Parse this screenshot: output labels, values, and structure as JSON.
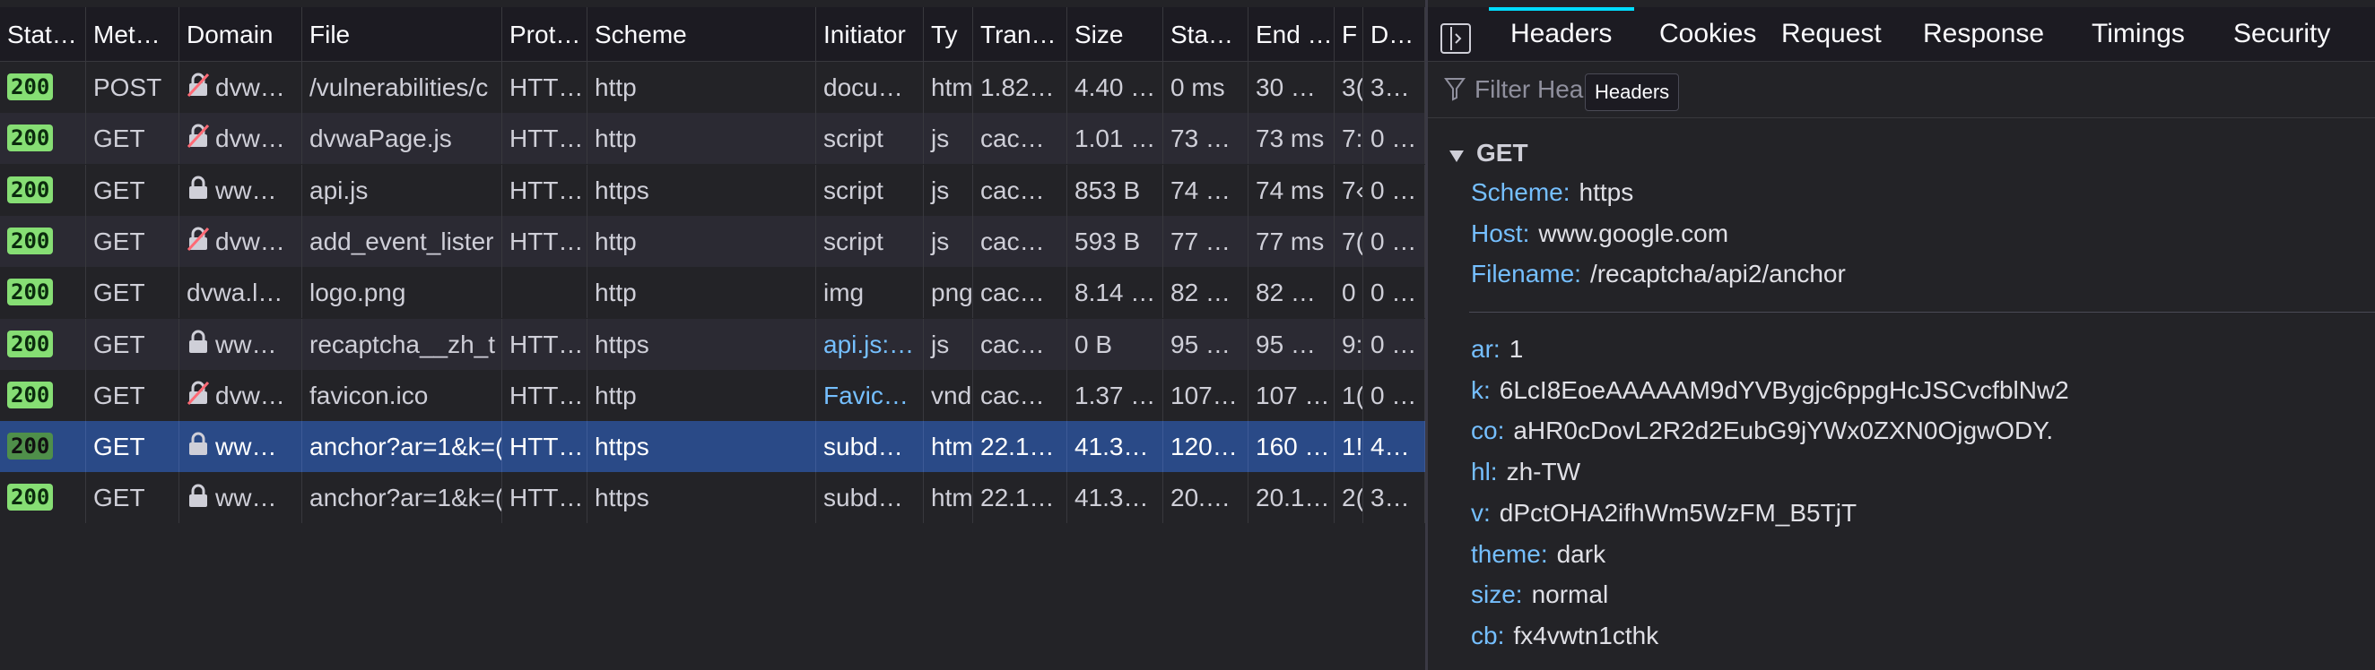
{
  "table": {
    "columns": [
      "Stat…",
      "Met…",
      "Domain",
      "File",
      "Prot…",
      "Scheme",
      "Initiator",
      "Ty",
      "Tran…",
      "Size",
      "Sta…",
      "End …",
      "F",
      "D…"
    ],
    "rows": [
      {
        "status": "200",
        "method": "POST",
        "domain": "dvw…",
        "domain_icon": "insecure-lock-icon",
        "file": "/vulnerabilities/c",
        "protocol": "HTT…",
        "scheme": "http",
        "initiator": "docu…",
        "type": "htm",
        "transferred": "1.82…",
        "size": "4.40 …",
        "start": "0 ms",
        "end": "30 …",
        "f": "3(",
        "d": "3…"
      },
      {
        "status": "200",
        "method": "GET",
        "domain": "dvw…",
        "domain_icon": "insecure-lock-icon",
        "file": "dvwaPage.js",
        "protocol": "HTT…",
        "scheme": "http",
        "initiator": "script",
        "type": "js",
        "transferred": "cac…",
        "size": "1.01 …",
        "start": "73 …",
        "end": "73 ms",
        "f": "7:",
        "d": "0 …"
      },
      {
        "status": "200",
        "method": "GET",
        "domain": "ww…",
        "domain_icon": "lock-icon",
        "file": "api.js",
        "protocol": "HTT…",
        "scheme": "https",
        "initiator": "script",
        "type": "js",
        "transferred": "cac…",
        "size": "853 B",
        "start": "74 …",
        "end": "74 ms",
        "f": "7‹",
        "d": "0 …"
      },
      {
        "status": "200",
        "method": "GET",
        "domain": "dvw…",
        "domain_icon": "insecure-lock-icon",
        "file": "add_event_lister",
        "protocol": "HTT…",
        "scheme": "http",
        "initiator": "script",
        "type": "js",
        "transferred": "cac…",
        "size": "593 B",
        "start": "77 …",
        "end": "77 ms",
        "f": "7(",
        "d": "0 …"
      },
      {
        "status": "200",
        "method": "GET",
        "domain": "dvwa.l…",
        "domain_icon": "",
        "file": "logo.png",
        "protocol": "",
        "scheme": "http",
        "initiator": "img",
        "type": "png",
        "transferred": "cac…",
        "size": "8.14 …",
        "start": "82 …",
        "end": "82 …",
        "f": "0",
        "d": "0 …"
      },
      {
        "status": "200",
        "method": "GET",
        "domain": "ww…",
        "domain_icon": "lock-icon",
        "file": "recaptcha__zh_t",
        "protocol": "HTT…",
        "scheme": "https",
        "initiator": "api.js:…",
        "initiator_link": true,
        "type": "js",
        "transferred": "cac…",
        "size": "0 B",
        "start": "95 …",
        "end": "95 …",
        "f": "9:",
        "d": "0 …"
      },
      {
        "status": "200",
        "method": "GET",
        "domain": "dvw…",
        "domain_icon": "insecure-lock-icon",
        "file": "favicon.ico",
        "protocol": "HTT…",
        "scheme": "http",
        "initiator": "Favic…",
        "initiator_link": true,
        "type": "vnd",
        "transferred": "cac…",
        "size": "1.37 …",
        "start": "107…",
        "end": "107 …",
        "f": "1(",
        "d": "0 …"
      },
      {
        "status": "200",
        "method": "GET",
        "domain": "ww…",
        "domain_icon": "lock-icon",
        "file": "anchor?ar=1&k=(",
        "protocol": "HTT…",
        "scheme": "https",
        "initiator": "subd…",
        "type": "htm",
        "transferred": "22.1…",
        "size": "41.3…",
        "start": "120…",
        "end": "160 …",
        "f": "1!",
        "d": "4…",
        "selected": true
      },
      {
        "status": "200",
        "method": "GET",
        "domain": "ww…",
        "domain_icon": "lock-icon",
        "file": "anchor?ar=1&k=(",
        "protocol": "HTT…",
        "scheme": "https",
        "initiator": "subd…",
        "type": "htm",
        "transferred": "22.1…",
        "size": "41.3…",
        "start": "20.…",
        "end": "20.1…",
        "f": "2(",
        "d": "3…"
      }
    ]
  },
  "panel": {
    "tabs": [
      "Headers",
      "Cookies",
      "Request",
      "Response",
      "Timings",
      "Security"
    ],
    "active_tab": "Headers",
    "filter_placeholder": "Filter Hea",
    "tooltip": "Headers",
    "section": "GET",
    "request_fields": [
      {
        "key": "Scheme:",
        "value": "https"
      },
      {
        "key": "Host:",
        "value": "www.google.com"
      },
      {
        "key": "Filename:",
        "value": "/recaptcha/api2/anchor"
      }
    ],
    "query_params": [
      {
        "key": "ar:",
        "value": "1"
      },
      {
        "key": "k:",
        "value": "6LcI8EoeAAAAAM9dYVBygjc6ppgHcJSCvcfblNw2"
      },
      {
        "key": "co:",
        "value": "aHR0cDovL2R2d2EubG9jYWx0ZXN0OjgwODY."
      },
      {
        "key": "hl:",
        "value": "zh-TW"
      },
      {
        "key": "v:",
        "value": "dPctOHA2ifhWm5WzFM_B5TjT"
      },
      {
        "key": "theme:",
        "value": "dark"
      },
      {
        "key": "size:",
        "value": "normal"
      },
      {
        "key": "cb:",
        "value": "fx4vwtn1cthk"
      }
    ]
  },
  "colors": {
    "accent": "#00ddff",
    "link": "#75bfff",
    "status_ok": "#86de74",
    "selected_row": "#2a4a87"
  }
}
